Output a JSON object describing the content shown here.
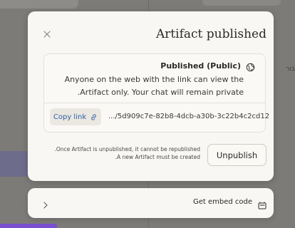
{
  "modal": {
    "title": "Artifact published",
    "close_icon": "close-icon",
    "status": "Published (Public)",
    "status_icon": "globe-icon",
    "description_line1": "Anyone on the web with the link can view the",
    "description_line2": ".Artifact only. Your chat will remain private",
    "copy_link_label": "Copy link",
    "copy_link_icon": "link-icon",
    "link_url": ".../5d909c7e-82b8-4dcb-a30b-3c22b4c2cd12",
    "link_color": "#2d5fa8",
    "warning_line1": ".Once Artifact is unpublished, it cannot be republished",
    "warning_line2": ".A new Artifact must be created",
    "unpublish_label": "Unpublish"
  },
  "embed": {
    "label": "Get embed code",
    "chevron_icon": "chevron-right-icon",
    "embed_icon": "embed-icon"
  },
  "background": {
    "side_text": "בור"
  }
}
